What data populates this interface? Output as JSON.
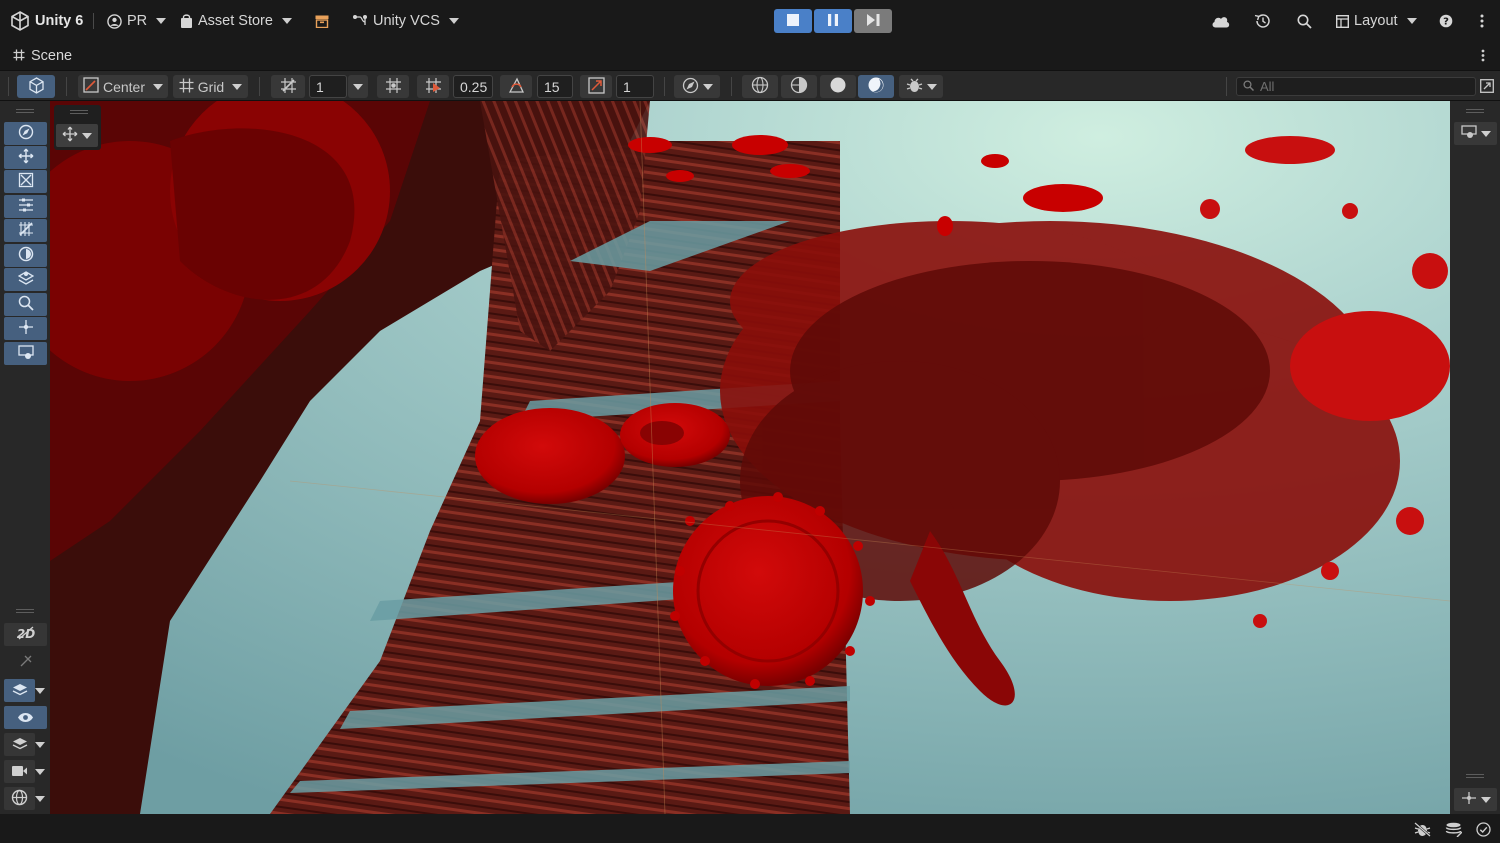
{
  "app": {
    "logo_icon": "unity-cube-icon",
    "product_label": "Unity 6",
    "account_label": "PR",
    "asset_store_label": "Asset Store",
    "vcs_label": "Unity VCS",
    "layout_label": "Layout"
  },
  "play_controls": {
    "play_state": "playing",
    "icons": [
      "stop-icon",
      "pause-icon",
      "step-icon"
    ]
  },
  "scene_tab": {
    "label": "Scene"
  },
  "scene_toolbar": {
    "pivot_label": "Center",
    "grid_label": "Grid",
    "grid_size": "1",
    "snap_increment": "0.25",
    "rotate_snap": "15",
    "scale_snap": "1",
    "search_placeholder": "All"
  },
  "left_tools": [
    "view-tool-icon",
    "move-tool-icon",
    "rotate-tool-icon",
    "scale-tool-icon",
    "rect-tool-icon",
    "transform-tool-icon",
    "sphere-tool-icon",
    "layers-tool-icon",
    "zoom-tool-icon",
    "pivot-tool-icon",
    "camera-tool-icon"
  ],
  "colors": {
    "accent": "#4a80c8",
    "selected": "#46607f",
    "panel": "#282828",
    "chrome": "#191919",
    "blood": "#b20000",
    "sky": "#a8d0cc"
  }
}
